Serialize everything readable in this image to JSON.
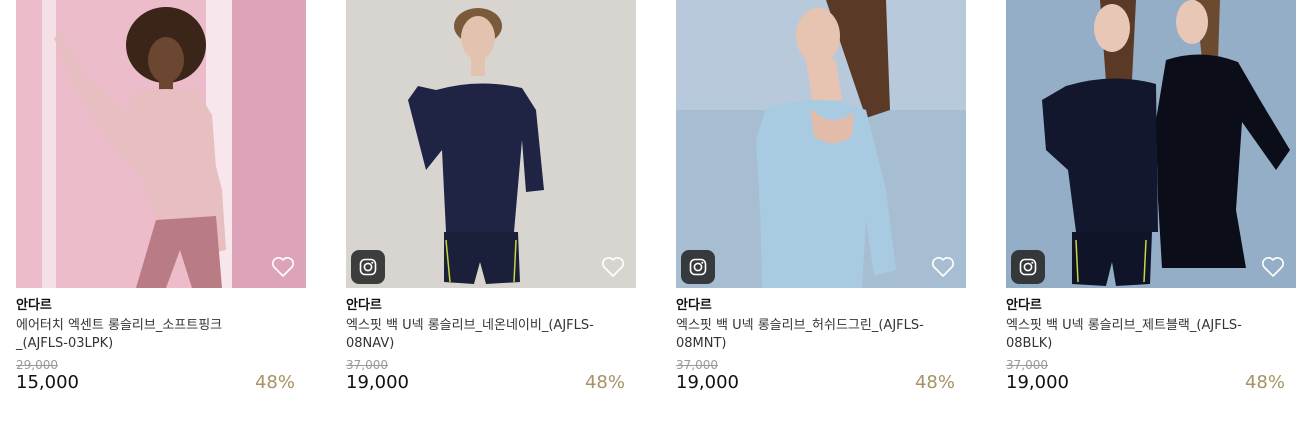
{
  "products": [
    {
      "brand": "안다르",
      "name_line1": "에어터치 엑센트 롱슬리브_소프트핑크",
      "name_line2": "_(AJFLS-03LPK)",
      "original_price": "29,000",
      "price": "15,000",
      "discount": "48%",
      "has_instagram_badge": false,
      "image_colors": {
        "background": "#e8b8c8",
        "garment": "#e7bfc0",
        "skin": "#6b4631",
        "hair": "#3a2518"
      }
    },
    {
      "brand": "안다르",
      "name_line1": "엑스핏 백 U넥 롱슬리브_네온네이비_(AJFLS-",
      "name_line2": "08NAV)",
      "original_price": "37,000",
      "price": "19,000",
      "discount": "48%",
      "has_instagram_badge": true,
      "image_colors": {
        "background": "#d6d3cf",
        "garment": "#1f2445",
        "skin": "#e3c3b0",
        "hair": "#7a5a3a"
      }
    },
    {
      "brand": "안다르",
      "name_line1": "엑스핏 백 U넥 롱슬리브_허쉬드그린_(AJFLS-",
      "name_line2": "08MNT)",
      "original_price": "37,000",
      "price": "19,000",
      "discount": "48%",
      "has_instagram_badge": true,
      "image_colors": {
        "background": "#9fb8cf",
        "garment": "#a9cbe2",
        "skin": "#e7c4b2",
        "hair": "#4a2f20"
      }
    },
    {
      "brand": "안다르",
      "name_line1": "엑스핏 백 U넥 롱슬리브_제트블랙_(AJFLS-",
      "name_line2": "08BLK)",
      "original_price": "37,000",
      "price": "19,000",
      "discount": "48%",
      "has_instagram_badge": true,
      "image_colors": {
        "background": "#8ba6c0",
        "garment": "#12172e",
        "skin": "#e8c7b6",
        "hair": "#5a3a26"
      }
    }
  ],
  "icons": {
    "wishlist": "heart-outline-icon",
    "badge": "instagram-icon"
  },
  "colors": {
    "discount": "#a69264",
    "original_price": "#9a9a9a"
  }
}
